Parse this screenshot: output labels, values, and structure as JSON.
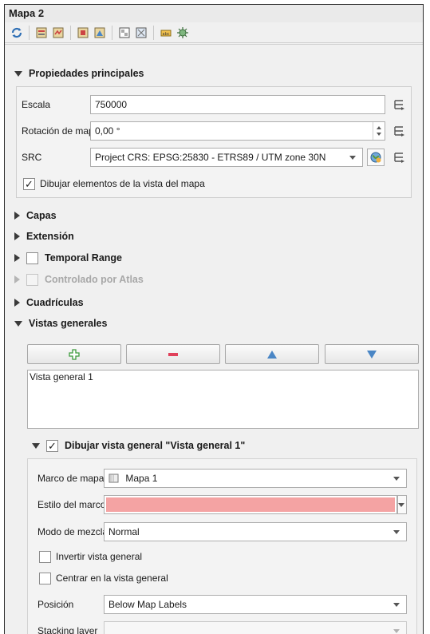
{
  "panel": {
    "title": "Mapa 2"
  },
  "toolbar": {
    "icons": [
      "refresh-icon",
      "item-properties-icon",
      "atlas-icon",
      "guides-icon",
      "layer-icon",
      "map-preview-icon",
      "overview-icon",
      "theme-icon",
      "label-icon",
      "settings-icon"
    ]
  },
  "main_properties": {
    "title": "Propiedades principales",
    "scale_label": "Escala",
    "scale_value": "750000",
    "rotation_label": "Rotación de mapa",
    "rotation_value": "0,00 °",
    "crs_label": "SRC",
    "crs_value": "Project CRS: EPSG:25830 - ETRS89 / UTM zone 30N",
    "draw_items_label": "Dibujar elementos de la vista del mapa",
    "draw_items_checked": true
  },
  "sections": {
    "layers": "Capas",
    "extent": "Extensión",
    "temporal": "Temporal Range",
    "atlas": "Controlado por Atlas",
    "grids": "Cuadrículas",
    "overviews": "Vistas generales"
  },
  "overviews": {
    "buttons": {
      "add": "+",
      "remove": "−",
      "up": "▲",
      "down": "▼"
    },
    "list": [
      "Vista general 1"
    ],
    "draw_overview_label": "Dibujar vista general \"Vista general 1\"",
    "draw_overview_checked": true,
    "map_frame_label": "Marco de mapa",
    "map_frame_value": "Mapa 1",
    "frame_style_label": "Estilo del marco",
    "frame_style_color": "#f4a3a3",
    "blend_mode_label": "Modo de mezcla",
    "blend_mode_value": "Normal",
    "invert_label": "Invertir vista general",
    "invert_checked": false,
    "center_label": "Centrar en la vista general",
    "center_checked": false,
    "position_label": "Posición",
    "position_value": "Below Map Labels",
    "stacking_label": "Stacking layer",
    "stacking_value": ""
  },
  "colors": {
    "accent_green": "#3c9a3c",
    "accent_red": "#e0405a",
    "accent_blue": "#4a86c5",
    "frame_pink": "#f4a3a3"
  }
}
